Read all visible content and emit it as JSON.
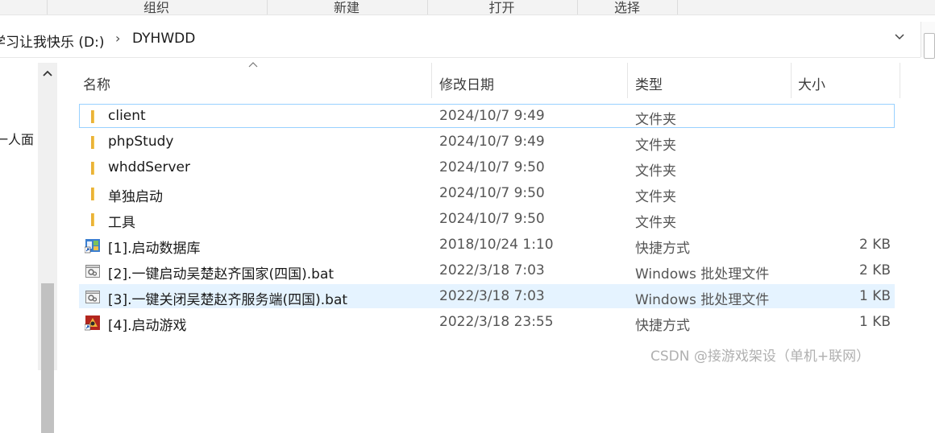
{
  "ribbon": {
    "groups": [
      "组织",
      "新建",
      "打开",
      "选择"
    ]
  },
  "address": {
    "drive_crumb": "学习让我快乐 (D:)",
    "folder_crumb": "DYHWDD",
    "separator_glyph": "›",
    "dropdown_glyph": "⌄"
  },
  "nav": {
    "partial_item": "一人面"
  },
  "columns": {
    "name": "名称",
    "date": "修改日期",
    "type": "类型",
    "size": "大小",
    "sort_glyph": "^"
  },
  "files": [
    {
      "name": "client",
      "date": "2024/10/7 9:49",
      "type": "文件夹",
      "size": "",
      "icon": "folder-icon"
    },
    {
      "name": "phpStudy",
      "date": "2024/10/7 9:49",
      "type": "文件夹",
      "size": "",
      "icon": "folder-icon"
    },
    {
      "name": "whddServer",
      "date": "2024/10/7 9:50",
      "type": "文件夹",
      "size": "",
      "icon": "folder-icon"
    },
    {
      "name": "单独启动",
      "date": "2024/10/7 9:50",
      "type": "文件夹",
      "size": "",
      "icon": "folder-icon"
    },
    {
      "name": "工具",
      "date": "2024/10/7 9:50",
      "type": "文件夹",
      "size": "",
      "icon": "folder-icon"
    },
    {
      "name": "[1].启动数据库",
      "date": "2018/10/24 1:10",
      "type": "快捷方式",
      "size": "2 KB",
      "icon": "database-shortcut-icon"
    },
    {
      "name": "[2].一键启动吴楚赵齐国家(四国).bat",
      "date": "2022/3/18 7:03",
      "type": "Windows 批处理文件",
      "size": "2 KB",
      "icon": "batch-file-icon"
    },
    {
      "name": "[3].一键关闭吴楚赵齐服务端(四国).bat",
      "date": "2022/3/18 7:03",
      "type": "Windows 批处理文件",
      "size": "1 KB",
      "icon": "batch-file-icon"
    },
    {
      "name": "[4].启动游戏",
      "date": "2022/3/18 23:55",
      "type": "快捷方式",
      "size": "1 KB",
      "icon": "game-shortcut-icon"
    }
  ],
  "colors": {
    "folder": "#f8c94a",
    "selection_border": "#99d1ff",
    "hover_bg": "#e5f3ff"
  },
  "watermark": "CSDN @接游戏架设（单机+联网）"
}
